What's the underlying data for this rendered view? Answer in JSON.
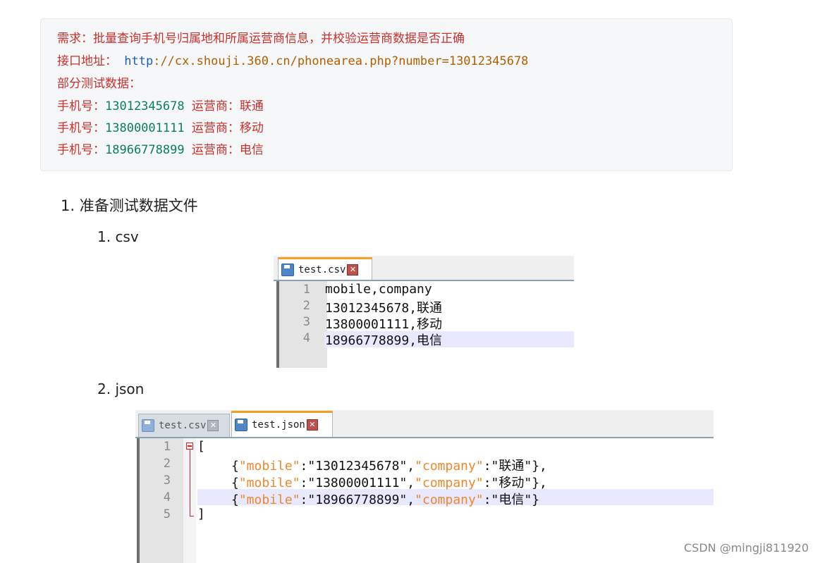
{
  "requirement_block": {
    "line1": "需求：批量查询手机号归属地和所属运营商信息，并校验运营商数据是否正确",
    "line2_label": "接口地址：",
    "line2_url_scheme": "http",
    "line2_url_rest": "://cx.shouji.360.cn/phonearea.php?number=13012345678",
    "line3": "部分测试数据：",
    "rows": [
      {
        "label": "手机号：",
        "phone": "13012345678",
        "carrier_label": "运营商：",
        "carrier": "联通"
      },
      {
        "label": "手机号：",
        "phone": "13800001111",
        "carrier_label": "运营商：",
        "carrier": "移动"
      },
      {
        "label": "手机号：",
        "phone": "18966778899",
        "carrier_label": "运营商：",
        "carrier": "电信"
      }
    ]
  },
  "list": {
    "item1": "1. 准备测试数据文件",
    "sub1": "1. csv",
    "sub2": "2. json"
  },
  "csv_editor": {
    "tab_label": "test.csv",
    "lines": [
      "mobile,company",
      "13012345678,联通",
      "13800001111,移动",
      "18966778899,电信"
    ],
    "line_numbers": [
      "1",
      "2",
      "3",
      "4"
    ]
  },
  "json_editor": {
    "tabs": [
      {
        "label": "test.csv",
        "active": false
      },
      {
        "label": "test.json",
        "active": true
      }
    ],
    "line_numbers": [
      "1",
      "2",
      "3",
      "4",
      "5"
    ],
    "open_bracket": "[",
    "close_bracket": "]",
    "entries": [
      {
        "mobile": "13012345678",
        "company": "联通",
        "trail": "},"
      },
      {
        "mobile": "13800001111",
        "company": "移动",
        "trail": "},"
      },
      {
        "mobile": "18966778899",
        "company": "电信",
        "trail": "}"
      }
    ],
    "key_mobile": "\"mobile\"",
    "key_company": "\"company\""
  },
  "watermark": "CSDN @mingji811920",
  "colors": {
    "red": "#c9302c",
    "url_blue": "#1f5db8",
    "green": "#0a7f5c",
    "tab_accent": "#f5a022",
    "json_key": "#f0882a",
    "highlight": "#e8e8ff"
  }
}
